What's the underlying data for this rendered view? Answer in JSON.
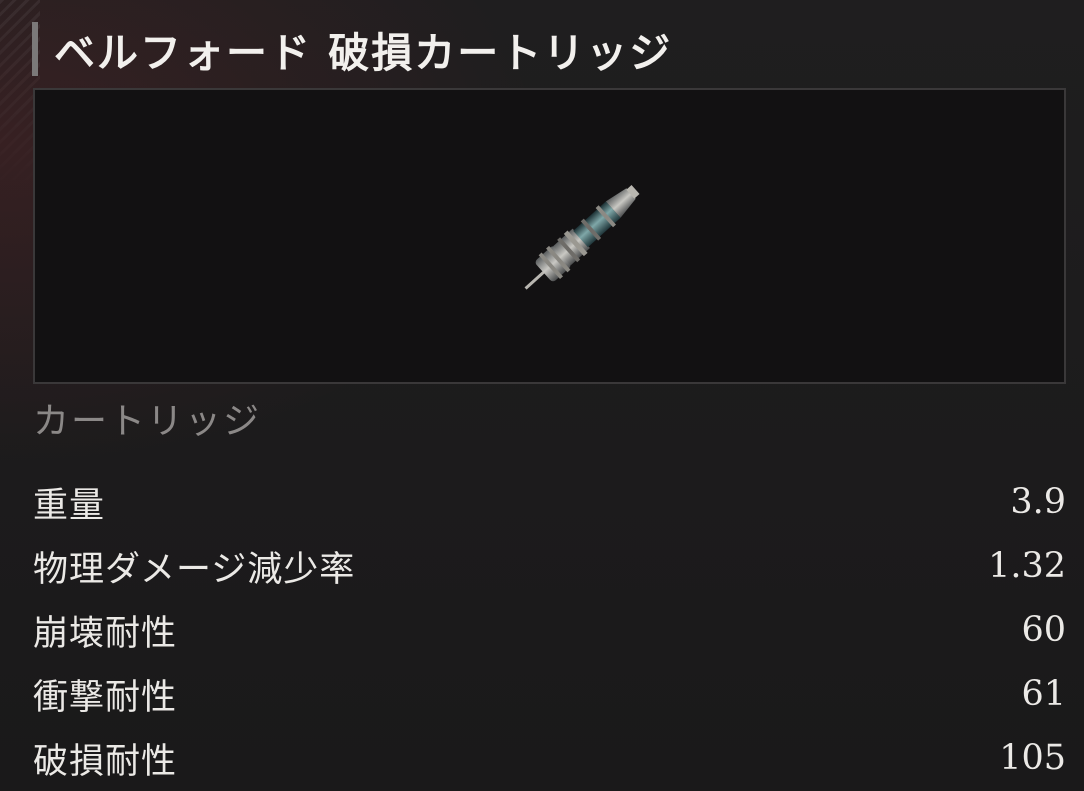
{
  "item": {
    "title": "ベルフォード 破損カートリッジ",
    "category": "カートリッジ",
    "image_icon": "cartridge-icon"
  },
  "stats": [
    {
      "name": "重量",
      "value": "3.9"
    },
    {
      "name": "物理ダメージ減少率",
      "value": "1.32"
    },
    {
      "name": "崩壊耐性",
      "value": "60"
    },
    {
      "name": "衝撃耐性",
      "value": "61"
    },
    {
      "name": "破損耐性",
      "value": "105"
    }
  ],
  "colors": {
    "background": "#1c1b1c",
    "text": "#ebe9e6",
    "muted_text": "#8b8887",
    "accent_bar": "#7b7979",
    "frame_border": "#3a3839"
  }
}
